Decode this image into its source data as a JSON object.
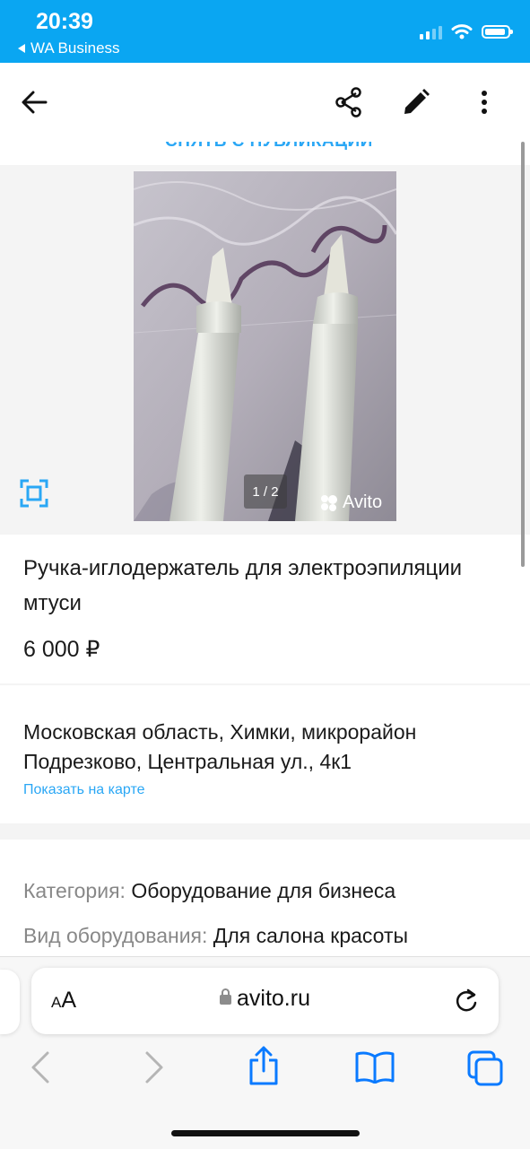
{
  "status_bar": {
    "time": "20:39",
    "back_app": "WA Business",
    "icons": [
      "signal-icon",
      "wifi-icon",
      "battery-icon"
    ]
  },
  "app_bar": {
    "icons": [
      "arrow-back-icon",
      "share-icon",
      "edit-pencil-icon",
      "more-vert-icon"
    ]
  },
  "listing": {
    "unpublish_label": "СНЯТЬ С ПУБЛИКАЦИИ",
    "gallery_counter": "1 / 2",
    "watermark": "Avito",
    "title": "Ручка-иглодержатель для электроэпиляции мтуси",
    "price": "6 000 ₽",
    "address": "Московская область, Химки, микрорайон Подрезково, Центральная ул., 4к1",
    "map_link": "Показать на карте",
    "properties": [
      {
        "key": "Категория:",
        "value": "Оборудование для бизнеса"
      },
      {
        "key": "Вид оборудования:",
        "value": "Для салона красоты"
      }
    ]
  },
  "browser": {
    "text_size_small": "A",
    "text_size_large": "A",
    "url": "avito.ru",
    "toolbar_icons": [
      "back-icon",
      "forward-icon",
      "share-icon",
      "bookmarks-icon",
      "tabs-icon"
    ]
  },
  "colors": {
    "status_bar_bg": "#0aa6f2",
    "accent": "#2aa7f5",
    "safari_blue": "#0a7aff"
  }
}
